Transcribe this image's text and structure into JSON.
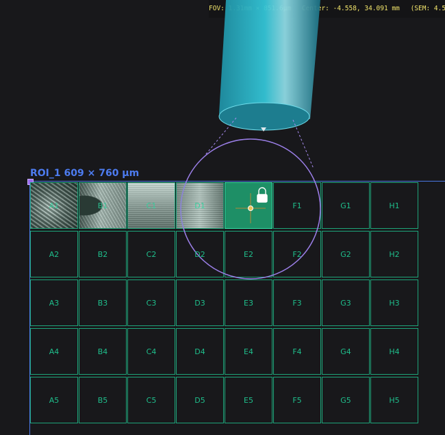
{
  "status": {
    "fov": "FOV: 1.31mm × 851.6µm",
    "center": "Center: -4.558,  34.091 mm",
    "sem": "(SEM:  4.5"
  },
  "roi": {
    "label": "ROI_1 609 × 760 µm",
    "color": "#4a78e6"
  },
  "grid": {
    "columns": [
      "A",
      "B",
      "C",
      "D",
      "E",
      "F",
      "G",
      "H"
    ],
    "rows": [
      "1",
      "2",
      "3",
      "4",
      "5"
    ],
    "imaged_tiles": [
      "A1",
      "B1",
      "C1",
      "D1"
    ],
    "selected_tile": "E1",
    "locked_tile": "E1",
    "tile_color": "#1ea57a"
  },
  "icons": {
    "lock": "lock-icon",
    "crosshair": "crosshair-icon",
    "beam": "electron-column-icon",
    "fov_circle": "field-of-view-circle"
  }
}
